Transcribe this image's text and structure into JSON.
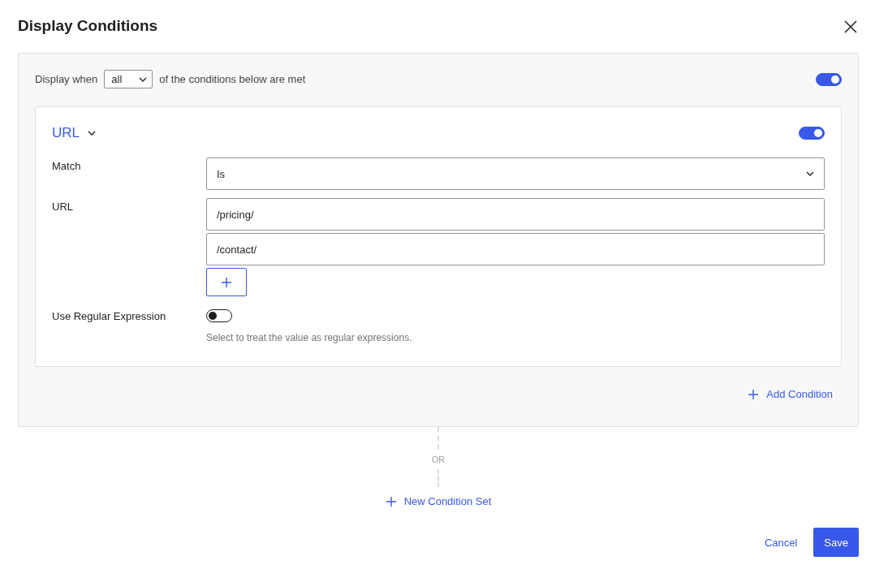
{
  "dialog": {
    "title": "Display Conditions"
  },
  "condition_set": {
    "enabled": true,
    "prefix": "Display when",
    "quantifier": "all",
    "suffix": "of the conditions below are met",
    "conditions": [
      {
        "name": "URL",
        "expanded": true,
        "enabled": true,
        "match_label": "Match",
        "match_value": "Is",
        "url_label": "URL",
        "urls": [
          "/pricing/",
          "/contact/"
        ],
        "regex_label": "Use Regular Expression",
        "regex_on": false,
        "regex_help": "Select to treat the value as regular expressions."
      }
    ],
    "add_condition": "Add Condition"
  },
  "separator": "OR",
  "new_set": "New Condition Set",
  "footer": {
    "cancel": "Cancel",
    "save": "Save"
  }
}
